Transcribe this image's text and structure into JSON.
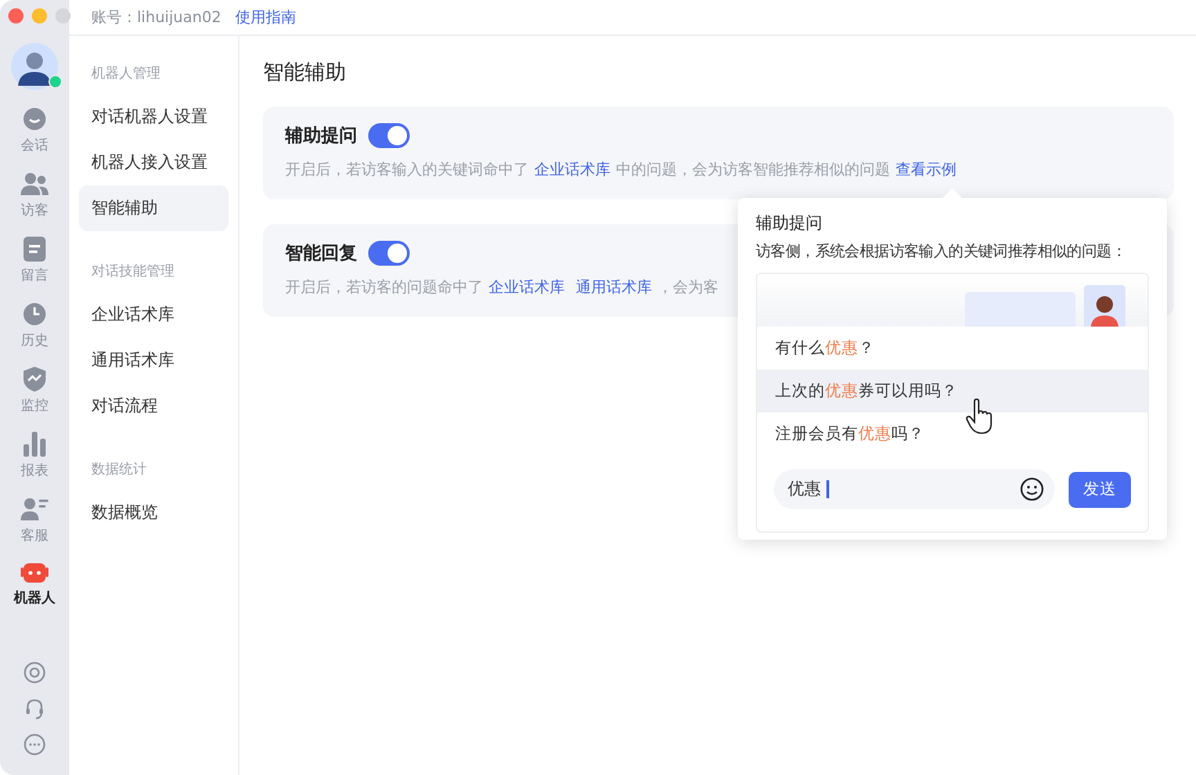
{
  "top_bar": {
    "account_label": "账号：lihuijuan02",
    "guide_link": "使用指南"
  },
  "rail": {
    "items": [
      {
        "label": "会话",
        "selected": false
      },
      {
        "label": "访客",
        "selected": false
      },
      {
        "label": "留言",
        "selected": false
      },
      {
        "label": "历史",
        "selected": false
      },
      {
        "label": "监控",
        "selected": false
      },
      {
        "label": "报表",
        "selected": false
      },
      {
        "label": "客服",
        "selected": false
      },
      {
        "label": "机器人",
        "selected": true
      }
    ]
  },
  "nav": {
    "groups": [
      {
        "heading": "机器人管理",
        "items": [
          {
            "label": "对话机器人设置",
            "selected": false
          },
          {
            "label": "机器人接入设置",
            "selected": false
          },
          {
            "label": "智能辅助",
            "selected": true
          }
        ]
      },
      {
        "heading": "对话技能管理",
        "items": [
          {
            "label": "企业话术库",
            "selected": false
          },
          {
            "label": "通用话术库",
            "selected": false
          },
          {
            "label": "对话流程",
            "selected": false
          }
        ]
      },
      {
        "heading": "数据统计",
        "items": [
          {
            "label": "数据概览",
            "selected": false
          }
        ]
      }
    ]
  },
  "page": {
    "title": "智能辅助",
    "cards": [
      {
        "title": "辅助提问",
        "on": true,
        "description": [
          {
            "kind": "text",
            "text": "开启后，若访客输入的关键词命中了"
          },
          {
            "kind": "link",
            "text": "企业话术库"
          },
          {
            "kind": "text",
            "text": "中的问题，会为访客智能推荐相似的问题"
          },
          {
            "kind": "link",
            "text": "查看示例"
          }
        ]
      },
      {
        "title": "智能回复",
        "on": true,
        "description": [
          {
            "kind": "text",
            "text": "开启后，若访客的问题命中了"
          },
          {
            "kind": "link",
            "text": "企业话术库"
          },
          {
            "kind": "link",
            "text": "通用话术库"
          },
          {
            "kind": "text",
            "text": "，会为客"
          }
        ]
      }
    ]
  },
  "popover": {
    "title": "辅助提问",
    "subtitle": "访客侧，系统会根据访客输入的关键词推荐相似的问题：",
    "suggestions": [
      {
        "before": "有什么",
        "keyword": "优惠",
        "after": "？",
        "selected": false
      },
      {
        "before": "上次的",
        "keyword": "优惠",
        "after": "券可以用吗？",
        "selected": true
      },
      {
        "before": "注册会员有",
        "keyword": "优惠",
        "after": "吗？",
        "selected": false
      }
    ],
    "input_value": "优惠",
    "send_button": "发送"
  }
}
